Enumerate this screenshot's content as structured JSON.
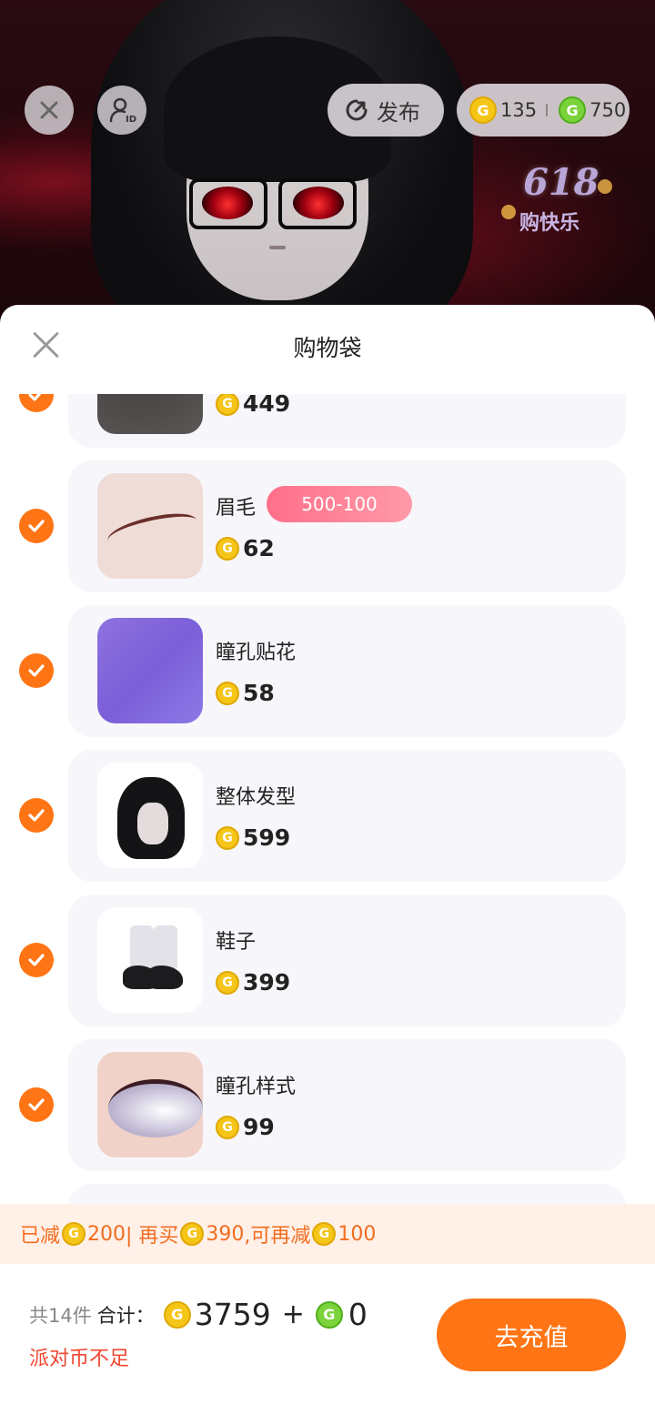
{
  "top_bar": {
    "publish_label": "发布",
    "gold_balance": "135",
    "green_balance": "750"
  },
  "promo_badge": {
    "line1": "618",
    "line2": "购快乐"
  },
  "sheet": {
    "title": "购物袋"
  },
  "items": [
    {
      "name": "",
      "price": "449",
      "checked": true
    },
    {
      "name": "眉毛",
      "price": "62",
      "tag": "500-100",
      "checked": true
    },
    {
      "name": "瞳孔贴花",
      "price": "58",
      "checked": true
    },
    {
      "name": "整体发型",
      "price": "599",
      "checked": true
    },
    {
      "name": "鞋子",
      "price": "399",
      "checked": true
    },
    {
      "name": "瞳孔样式",
      "price": "99",
      "checked": true
    }
  ],
  "discount": {
    "reduced_prefix": "已减",
    "reduced_amount": "200",
    "buy_more_prefix": " | 再买",
    "buy_more_amount": "390",
    "more_reduce_prefix": ",可再减",
    "more_reduce_amount": "100"
  },
  "footer": {
    "count_text": "共14件",
    "sum_label": "合计：",
    "gold_total": "3759",
    "plus": "+",
    "green_total": "0",
    "insufficient_text": "派对币不足",
    "recharge_label": "去充值"
  },
  "colors": {
    "accent": "#ff7414",
    "promo_tag": "#ff6f8a",
    "discount_bg": "#fff0e8",
    "warning": "#f04830"
  }
}
